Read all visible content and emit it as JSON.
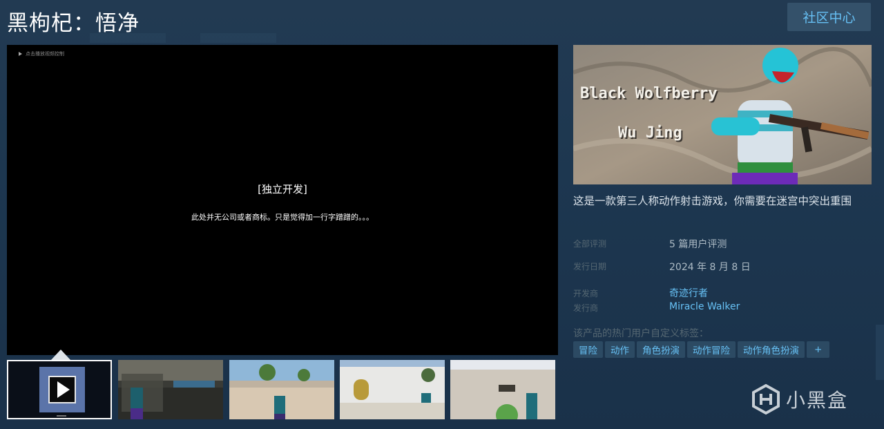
{
  "page_title": "黑枸杞：悟净",
  "community_hub_label": "社区中心",
  "video": {
    "source_text": "点击播放视频控制",
    "headline": "[独立开发]",
    "subline": "此处并无公司或者商标。只是觉得加一行字蹭蹭的。。。"
  },
  "capsule": {
    "title_line1": "Black Wolfberry",
    "title_line2": "Wu Jing"
  },
  "description": "这是一款第三人称动作射击游戏，你需要在迷宫中突出重围",
  "info": {
    "reviews_label": "全部评测",
    "reviews_value": "5 篇用户评测",
    "release_label": "发行日期",
    "release_value": "2024 年 8 月 8 日",
    "developer_label": "开发商",
    "developer_value": "奇迹行者",
    "publisher_label": "发行商",
    "publisher_value": "Miracle Walker"
  },
  "tags_label": "该产品的热门用户自定义标签：",
  "tags": [
    "冒险",
    "动作",
    "角色扮演",
    "动作冒险",
    "动作角色扮演",
    "+"
  ],
  "watermark": "小黑盒",
  "colors": {
    "accent_link": "#67c1f5",
    "tag_bg": "#2c4a63",
    "hub_button_bg": "#34516a"
  }
}
